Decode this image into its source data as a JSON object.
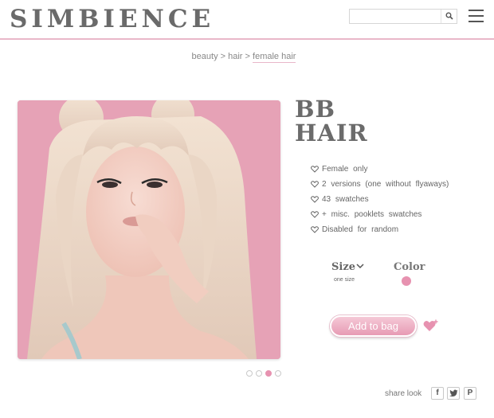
{
  "header": {
    "logo": "SIMBIENCE",
    "search": {
      "placeholder": "",
      "value": ""
    }
  },
  "breadcrumb": {
    "items": [
      "beauty",
      "hair",
      "female hair"
    ],
    "separator": " > "
  },
  "product": {
    "title_line1": "BB",
    "title_line2": "HAIR",
    "features": [
      "Female only",
      "2 versions (one without flyaways)",
      "43 swatches",
      "+ misc. pooklets swatches",
      "Disabled for random"
    ],
    "size": {
      "label": "Size",
      "value": "one size"
    },
    "color": {
      "label": "Color",
      "swatch": "#e792b0"
    },
    "add_to_bag_label": "Add to bag"
  },
  "carousel": {
    "count": 4,
    "active_index": 2
  },
  "share": {
    "label": "share look",
    "buttons": [
      "f",
      "twitter",
      "P"
    ]
  },
  "colors": {
    "accent": "#e792b0",
    "header_border": "#e9b7c9",
    "image_background": "#e6a2b6"
  }
}
